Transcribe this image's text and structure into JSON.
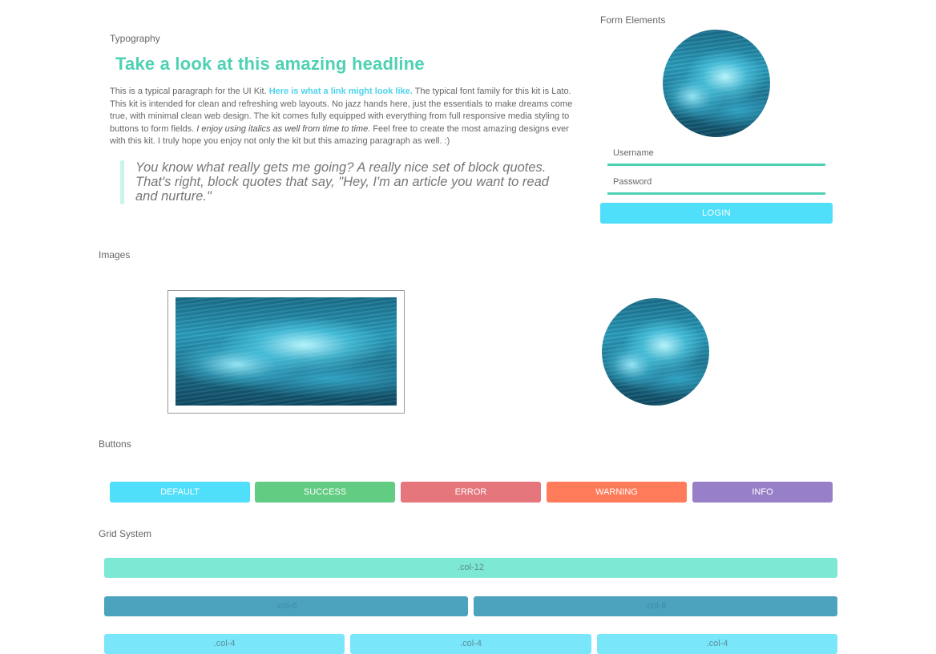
{
  "typography": {
    "label": "Typography",
    "headline": "Take a look at this amazing headline",
    "paragraph": {
      "part1": "This is a typical paragraph for the UI Kit. ",
      "link": "Here is what a link might look like.",
      "part2": " The typical font family for this kit is Lato. This kit is intended for clean and refreshing web layouts. No jazz hands here, just the essentials to make dreams come true, with minimal clean web design. The kit comes fully equipped with everything from full responsive media styling to buttons to form fields. ",
      "italic": "I enjoy using italics as well from time to time.",
      "part3": " Feel free to create the most amazing designs ever with this kit. I truly hope you enjoy not only the kit but this amazing paragraph as well. :)"
    },
    "blockquote": "You know what really gets me going? A really nice set of block quotes. That's right, block quotes that say, \"Hey, I'm an article you want to read and nurture.\""
  },
  "form": {
    "label": "Form Elements",
    "username_placeholder": "Username",
    "password_placeholder": "Password",
    "login_label": "LOGIN",
    "accent": "#4fd1b4",
    "button_color": "#50dffa"
  },
  "images": {
    "label": "Images"
  },
  "buttons": {
    "label": "Buttons",
    "items": [
      {
        "label": "DEFAULT",
        "color": "#50dffa"
      },
      {
        "label": "SUCCESS",
        "color": "#62cc83"
      },
      {
        "label": "ERROR",
        "color": "#e5767c"
      },
      {
        "label": "WARNING",
        "color": "#ff7b5a"
      },
      {
        "label": "INFO",
        "color": "#9880c8"
      }
    ]
  },
  "grid": {
    "label": "Grid System",
    "col12": ".col-12",
    "col6": [
      ".col-6",
      ".col-6"
    ],
    "col4": [
      ".col-4",
      ".col-4",
      ".col-4"
    ],
    "colors": {
      "col12": "#7de8d3",
      "col6": "#4ba3be",
      "col4": "#7ae6fa"
    }
  }
}
